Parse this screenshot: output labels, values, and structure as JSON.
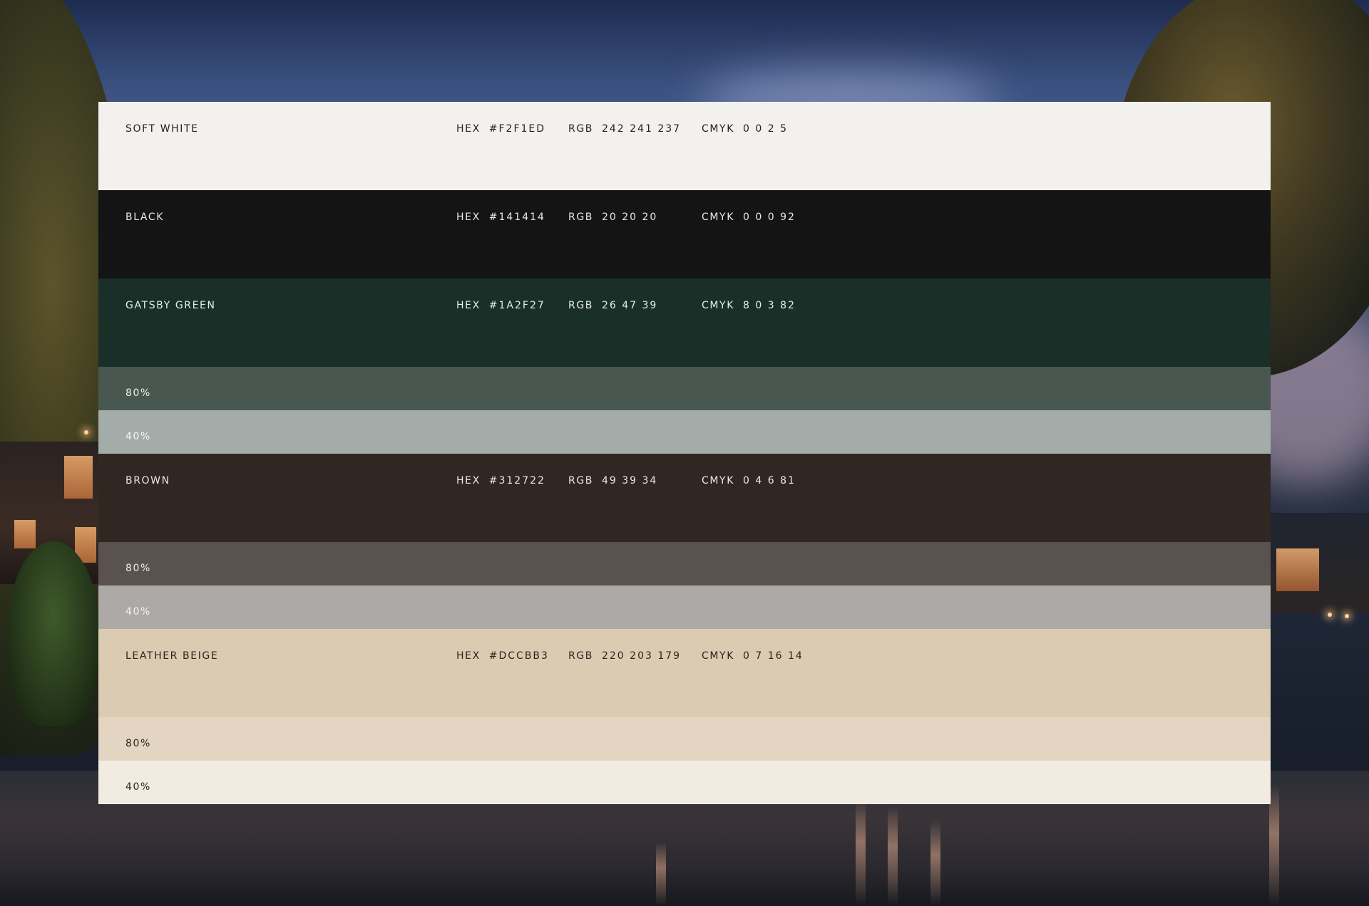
{
  "colors": {
    "soft_white": "#F2F1ED",
    "black": "#141414",
    "gatsby_green": "#1A2F27",
    "gatsby_green_80": "#48574F",
    "gatsby_green_40": "#A3ACA9",
    "brown": "#312722",
    "brown_80": "#5A524F",
    "brown_40": "#ADA9A7",
    "leather_beige": "#DCCBB3",
    "leather_beige_80": "#E3D5C2",
    "leather_beige_40": "#F1EBE2"
  },
  "swatches": [
    {
      "name": "SOFT WHITE",
      "hex_label": "HEX",
      "hex": "#F2F1ED",
      "rgb_label": "RGB",
      "rgb": "242 241 237",
      "cmyk_label": "CMYK",
      "cmyk": "0 0 2 5"
    },
    {
      "name": "BLACK",
      "hex_label": "HEX",
      "hex": "#141414",
      "rgb_label": "RGB",
      "rgb": "20 20 20",
      "cmyk_label": "CMYK",
      "cmyk": "0 0 0 92"
    },
    {
      "name": "GATSBY GREEN",
      "hex_label": "HEX",
      "hex": "#1A2F27",
      "rgb_label": "RGB",
      "rgb": "26 47 39",
      "cmyk_label": "CMYK",
      "cmyk": "8 0 3 82",
      "tints": [
        "80%",
        "40%"
      ]
    },
    {
      "name": "BROWN",
      "hex_label": "HEX",
      "hex": "#312722",
      "rgb_label": "RGB",
      "rgb": "49 39 34",
      "cmyk_label": "CMYK",
      "cmyk": "0 4 6 81",
      "tints": [
        "80%",
        "40%"
      ]
    },
    {
      "name": "LEATHER BEIGE",
      "hex_label": "HEX",
      "hex": "#DCCBB3",
      "rgb_label": "RGB",
      "rgb": "220 203 179",
      "cmyk_label": "CMYK",
      "cmyk": "0 7 16 14",
      "tints": [
        "80%",
        "40%"
      ]
    }
  ]
}
